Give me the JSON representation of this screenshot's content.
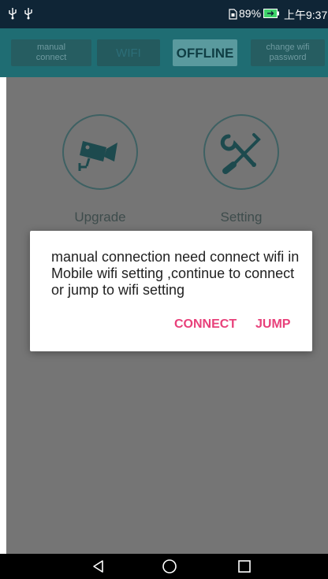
{
  "status_bar": {
    "battery_percent": "89%",
    "time": "上午9:37",
    "icons": [
      "usb-icon",
      "usb-icon",
      "sim-card-icon",
      "battery-charging-icon"
    ]
  },
  "header": {
    "manual_connect_label": "manual\nconnect",
    "wifi_label": "WIFI",
    "offline_label": "OFFLINE",
    "change_wifi_password_label": "change wifi\npassword"
  },
  "tools": [
    {
      "label": "Upgrade",
      "icon": "camera-icon"
    },
    {
      "label": "Setting",
      "icon": "tools-icon"
    }
  ],
  "dialog": {
    "message": "manual connection need connect wifi in Mobile wifi setting ,continue to connect or jump to wifi setting",
    "connect_label": "CONNECT",
    "jump_label": "JUMP"
  },
  "nav": {
    "icons": [
      "back-icon",
      "home-icon",
      "recents-icon"
    ]
  },
  "colors": {
    "header_bg": "#1f6d73",
    "dialog_accent": "#e8407a",
    "status_bar_bg": "#0f2536"
  }
}
